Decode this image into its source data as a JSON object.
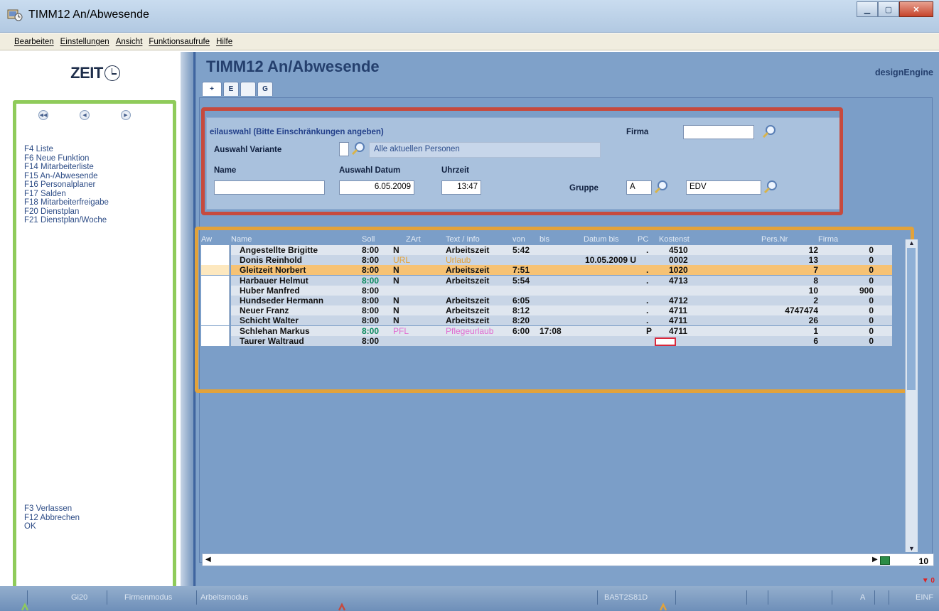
{
  "window": {
    "title": "TIMM12  An/Abwesende",
    "buttons": [
      "minimize",
      "maximize",
      "close"
    ]
  },
  "menu": [
    "Bearbeiten",
    "Einstellungen",
    "Ansicht",
    "Funktionsaufrufe",
    "Hilfe"
  ],
  "sidebar": {
    "logo": "ZEIT",
    "functions": [
      "F4 Liste",
      "F6 Neue Funktion",
      "F14 Mitarbeiterliste",
      "F15 An-/Abwesende",
      "F16 Personalplaner",
      "F17 Salden",
      "F18 Mitarbeiterfreigabe",
      "F20 Dienstplan",
      "F21 Dienstplan/Woche"
    ],
    "bottom": [
      "F3 Verlassen",
      "F12 Abbrechen",
      "OK"
    ]
  },
  "main": {
    "title": "TIMM12  An/Abwesende",
    "brand": "designEngine",
    "tabs": [
      "+",
      "E",
      "",
      "G"
    ]
  },
  "filter": {
    "header": "eilauswahl (Bitte Einschränkungen angeben)",
    "firma_label": "Firma",
    "firma_value": "",
    "variante_label": "Auswahl Variante",
    "variante_value": "",
    "variante_desc": "Alle aktuellen Personen",
    "name_label": "Name",
    "name_value": "",
    "datum_label": "Auswahl Datum",
    "datum_value": "6.05.2009",
    "uhrzeit_label": "Uhrzeit",
    "uhrzeit_value": "13:47",
    "gruppe_label": "Gruppe",
    "gruppe_code": "A",
    "gruppe_name": "EDV"
  },
  "grid": {
    "columns": [
      "Aw",
      "Name",
      "Soll",
      "ZArt",
      "Text / Info",
      "von",
      "bis",
      "Datum bis",
      "PC",
      "Kostenst",
      "Pers.Nr",
      "Firma"
    ],
    "rows": [
      {
        "name": "Angestellte Brigitte",
        "soll": "8:00",
        "zart": "N",
        "text": "Arbeitszeit",
        "von": "5:42",
        "bis": "",
        "datum_bis": "",
        "pc": ".",
        "kostenst": "4510",
        "persnr": "12",
        "firma": "0"
      },
      {
        "name": "Donis Reinhold",
        "soll": "8:00",
        "zart": "URL",
        "text": "Urlaub",
        "von": "",
        "bis": "",
        "datum_bis": "10.05.2009 U",
        "pc": "",
        "kostenst": "0002",
        "persnr": "13",
        "firma": "0"
      },
      {
        "name": "Gleitzeit Norbert",
        "soll": "8:00",
        "zart": "N",
        "text": "Arbeitszeit",
        "von": "7:51",
        "bis": "",
        "datum_bis": "",
        "pc": ".",
        "kostenst": "1020",
        "persnr": "7",
        "firma": "0"
      },
      {
        "name": "Harbauer Helmut",
        "soll": "8:00",
        "zart": "N",
        "text": "Arbeitszeit",
        "von": "5:54",
        "bis": "",
        "datum_bis": "",
        "pc": ".",
        "kostenst": "4713",
        "persnr": "8",
        "firma": "0"
      },
      {
        "name": "Huber Manfred",
        "soll": "8:00",
        "zart": "",
        "text": "",
        "von": "",
        "bis": "",
        "datum_bis": "",
        "pc": "",
        "kostenst": "",
        "persnr": "10",
        "firma": "900"
      },
      {
        "name": "Hundseder Hermann",
        "soll": "8:00",
        "zart": "N",
        "text": "Arbeitszeit",
        "von": "6:05",
        "bis": "",
        "datum_bis": "",
        "pc": ".",
        "kostenst": "4712",
        "persnr": "2",
        "firma": "0"
      },
      {
        "name": "Neuer Franz",
        "soll": "8:00",
        "zart": "N",
        "text": "Arbeitszeit",
        "von": "8:12",
        "bis": "",
        "datum_bis": "",
        "pc": ".",
        "kostenst": "4711",
        "persnr": "4747474",
        "firma": "0"
      },
      {
        "name": "Schicht Walter",
        "soll": "8:00",
        "zart": "N",
        "text": "Arbeitszeit",
        "von": "8:20",
        "bis": "",
        "datum_bis": "",
        "pc": ".",
        "kostenst": "4711",
        "persnr": "26",
        "firma": "0"
      },
      {
        "name": "Schlehan Markus",
        "soll": "8:00",
        "zart": "PFL",
        "text": "Pflegeurlaub",
        "von": "6:00",
        "bis": "17:08",
        "datum_bis": "",
        "pc": "P",
        "kostenst": "4711",
        "persnr": "1",
        "firma": "0"
      },
      {
        "name": "Taurer Waltraud",
        "soll": "8:00",
        "zart": "",
        "text": "",
        "von": "",
        "bis": "",
        "datum_bis": "",
        "pc": "",
        "kostenst": "",
        "persnr": "6",
        "firma": "0"
      }
    ],
    "page_count": "10"
  },
  "status": [
    "Gi20",
    "Firmenmodus",
    "Arbeitsmodus",
    "BA5T2S81D",
    "A",
    "EINF"
  ],
  "colors": {
    "sidebar_frame": "#8fcb5a",
    "filter_frame": "#c64a3e",
    "grid_frame": "#e2a23a",
    "selected_row": "#f6c274"
  }
}
